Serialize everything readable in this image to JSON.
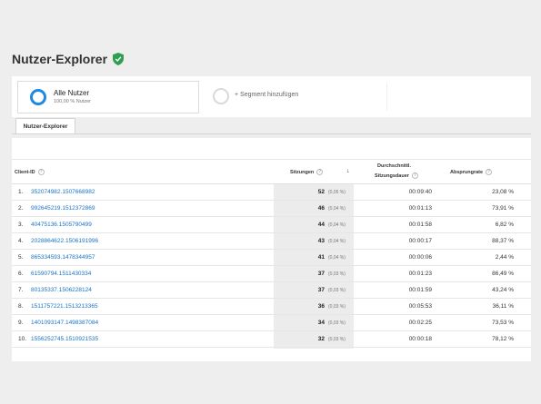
{
  "page": {
    "title": "Nutzer-Explorer"
  },
  "segments": {
    "active_name": "Alle Nutzer",
    "active_sub": "100,00 % Nutzer",
    "add_label": "+ Segment hinzufügen"
  },
  "tab": {
    "label": "Nutzer-Explorer"
  },
  "table": {
    "headers": {
      "client_id": "Client-ID",
      "sessions": "Sitzungen",
      "sort_arrow": "↓",
      "duration_line1": "Durchschnittl.",
      "duration_line2": "Sitzungsdauer",
      "bounce": "Absprungrate"
    },
    "rows": [
      {
        "num": "1.",
        "client_id": "352074982.1507668982",
        "sessions": "52",
        "pct": "(0,05 %)",
        "duration": "00:09:40",
        "bounce": "23,08 %"
      },
      {
        "num": "2.",
        "client_id": "992645219.1512372869",
        "sessions": "46",
        "pct": "(0,04 %)",
        "duration": "00:01:13",
        "bounce": "73,91 %"
      },
      {
        "num": "3.",
        "client_id": "40475136.1505790499",
        "sessions": "44",
        "pct": "(0,04 %)",
        "duration": "00:01:58",
        "bounce": "6,82 %"
      },
      {
        "num": "4.",
        "client_id": "2028864622.1506191996",
        "sessions": "43",
        "pct": "(0,04 %)",
        "duration": "00:00:17",
        "bounce": "88,37 %"
      },
      {
        "num": "5.",
        "client_id": "865334593.1478344957",
        "sessions": "41",
        "pct": "(0,04 %)",
        "duration": "00:00:06",
        "bounce": "2,44 %"
      },
      {
        "num": "6.",
        "client_id": "61590794.1511430334",
        "sessions": "37",
        "pct": "(0,03 %)",
        "duration": "00:01:23",
        "bounce": "86,49 %"
      },
      {
        "num": "7.",
        "client_id": "80135337.1506228124",
        "sessions": "37",
        "pct": "(0,03 %)",
        "duration": "00:01:59",
        "bounce": "43,24 %"
      },
      {
        "num": "8.",
        "client_id": "1511757221.1513213365",
        "sessions": "36",
        "pct": "(0,03 %)",
        "duration": "00:05:53",
        "bounce": "36,11 %"
      },
      {
        "num": "9.",
        "client_id": "1401093147.1498387084",
        "sessions": "34",
        "pct": "(0,03 %)",
        "duration": "00:02:25",
        "bounce": "73,53 %"
      },
      {
        "num": "10.",
        "client_id": "1556252745.1510921535",
        "sessions": "32",
        "pct": "(0,03 %)",
        "duration": "00:00:18",
        "bounce": "78,12 %"
      }
    ]
  },
  "colors": {
    "accent": "#1e88e5",
    "link": "#1a73c8",
    "verified": "#2e9e4f"
  },
  "icons": {
    "verified": "shield-check-icon",
    "help": "help-circle-icon",
    "sort": "arrow-down-icon"
  }
}
